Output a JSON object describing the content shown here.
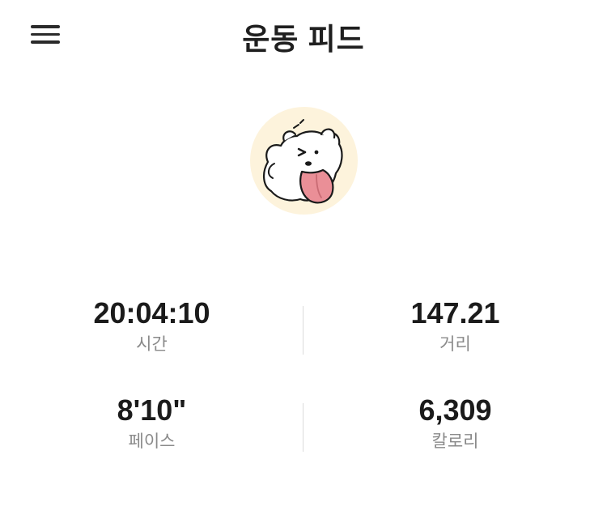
{
  "header": {
    "title": "운동 피드",
    "menu_icon": "hamburger-menu-icon"
  },
  "profile": {
    "avatar_icon": "cartoon-bear-avatar",
    "avatar_bg": "#fdf3dc"
  },
  "stats": {
    "time": {
      "value": "20:04:10",
      "label": "시간"
    },
    "distance": {
      "value": "147.21",
      "label": "거리"
    },
    "pace": {
      "value": "8'10\"",
      "label": "페이스"
    },
    "calories": {
      "value": "6,309",
      "label": "칼로리"
    }
  },
  "colors": {
    "value_text": "#1b1b1b",
    "label_text": "#8a8a8a",
    "divider": "#dcdcdc"
  }
}
